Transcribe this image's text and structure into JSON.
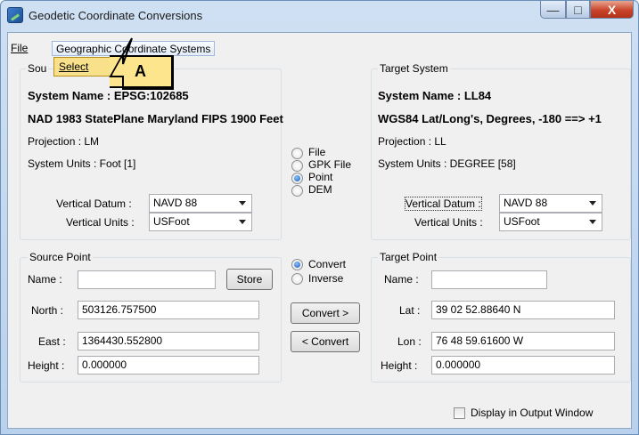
{
  "window": {
    "title": "Geodetic Coordinate Conversions",
    "min_glyph": "—",
    "max_glyph": "□",
    "close_glyph": "X"
  },
  "menu": {
    "file": "File",
    "geographic": "Geographic Coordinate Systems",
    "select_item": "Select"
  },
  "annotation": {
    "label": "A"
  },
  "source_system": {
    "group_title": "Sou",
    "system_name": "System Name : EPSG:102685",
    "description": "NAD 1983 StatePlane Maryland FIPS 1900 Feet",
    "projection": "Projection : LM",
    "units": "System Units : Foot [1]",
    "vertical_datum_label": "Vertical Datum :",
    "vertical_datum_value": "NAVD 88",
    "vertical_units_label": "Vertical Units :",
    "vertical_units_value": "USFoot"
  },
  "target_system": {
    "group_title": "Target System",
    "system_name": "System Name : LL84",
    "description": "WGS84 Lat/Long's, Degrees, -180 ==> +1",
    "projection": "Projection : LL",
    "units": "System Units : DEGREE [58]",
    "vertical_datum_label": "Vertical Datum :",
    "vertical_datum_value": "NAVD 88",
    "vertical_units_label": "Vertical Units :",
    "vertical_units_value": "USFoot"
  },
  "mode_options": [
    {
      "label": "File",
      "selected": false
    },
    {
      "label": "GPK File",
      "selected": false
    },
    {
      "label": "Point",
      "selected": true
    },
    {
      "label": "DEM",
      "selected": false
    }
  ],
  "direction_options": [
    {
      "label": "Convert",
      "selected": true
    },
    {
      "label": "Inverse",
      "selected": false
    }
  ],
  "source_point": {
    "group_title": "Source Point",
    "name_label": "Name :",
    "name_value": "",
    "store_button": "Store",
    "north_label": "North :",
    "north_value": "503126.757500",
    "east_label": "East :",
    "east_value": "1364430.552800",
    "height_label": "Height :",
    "height_value": "0.000000"
  },
  "target_point": {
    "group_title": "Target Point",
    "name_label": "Name :",
    "name_value": "",
    "lat_label": "Lat :",
    "lat_value": "39 02 52.88640 N",
    "lon_label": "Lon :",
    "lon_value": "76 48 59.61600 W",
    "height_label": "Height :",
    "height_value": "0.000000"
  },
  "buttons": {
    "convert_forward": "Convert >",
    "convert_back": "< Convert"
  },
  "output": {
    "display_label": "Display in Output Window",
    "checked": false
  }
}
